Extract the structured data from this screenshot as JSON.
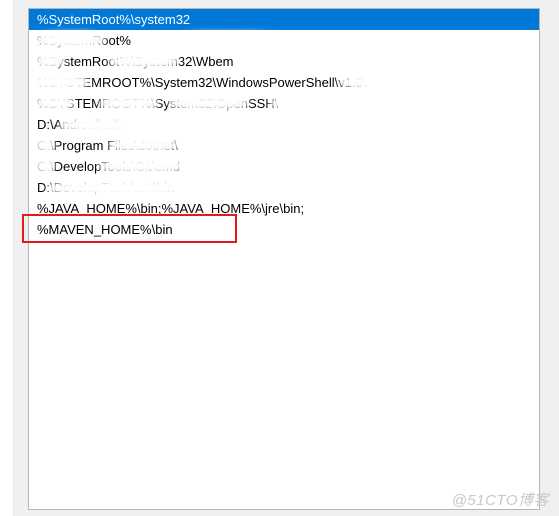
{
  "list": {
    "items": [
      {
        "text": "%SystemRoot%\\system32",
        "selected": true
      },
      {
        "text": "%SystemRoot%",
        "selected": false,
        "obscured": true
      },
      {
        "text": "%SystemRoot%\\System32\\Wbem",
        "selected": false,
        "obscured": true
      },
      {
        "text": "%SYSTEMROOT%\\System32\\WindowsPowerShell\\v1.0\\",
        "selected": false,
        "obscured": true
      },
      {
        "text": "%SYSTEMROOT%\\System32\\OpenSSH\\",
        "selected": false,
        "obscured": true
      },
      {
        "text": "D:\\Android\\sdk",
        "selected": false,
        "obscured": true
      },
      {
        "text": "C:\\Program Files\\dotnet\\",
        "selected": false,
        "obscured": true
      },
      {
        "text": "C:\\DevelopTools\\Git\\cmd",
        "selected": false,
        "obscured": true
      },
      {
        "text": "D:\\DevelopTools\\ant\\bin",
        "selected": false,
        "obscured": true
      },
      {
        "text": "%JAVA_HOME%\\bin;%JAVA_HOME%\\jre\\bin;",
        "selected": false
      },
      {
        "text": "%MAVEN_HOME%\\bin",
        "selected": false
      }
    ]
  },
  "highlight_index": 10,
  "watermark": "@51CTO博客"
}
